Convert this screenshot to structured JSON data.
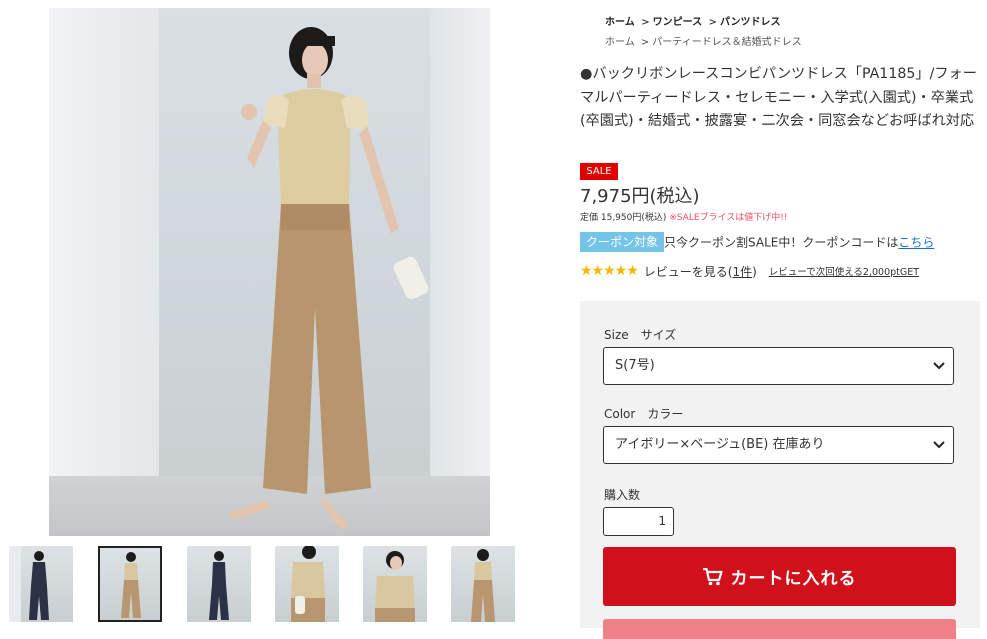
{
  "breadcrumb": {
    "row1": [
      "ホーム",
      "ワンピース",
      "パンツドレス"
    ],
    "row2": [
      "ホーム",
      "パーティードレス＆結婚式ドレス"
    ],
    "separator": ">"
  },
  "product": {
    "title": "●バックリボンレースコンビパンツドレス「PA1185」/フォーマルパーティードレス・セレモニー・入学式(入園式)・卒業式(卒園式)・結婚式・披露宴・二次会・同窓会などお呼ばれ対応",
    "sale_badge": "SALE",
    "price": "7,975円(税込)",
    "original_price": "定価 15,950円(税込)",
    "original_price_note": "※SALEプライスは値下げ中!!"
  },
  "coupon": {
    "tag": "クーポン対象",
    "text": "只今クーポン割SALE中！クーポンコードは",
    "link": "こちら"
  },
  "review": {
    "stars": 5,
    "stars_text": "★★★★★",
    "label": "レビューを見る(",
    "count": "1件",
    "label_end": ")",
    "promo": "レビューで次回使える2,000ptGET"
  },
  "options": {
    "size_label": "Size　サイズ",
    "size_value": "S(7号)",
    "color_label": "Color　カラー",
    "color_value": "アイボリー×ベージュ(BE)  在庫あり",
    "qty_label": "購入数",
    "qty_value": "1"
  },
  "cart": {
    "label": "カートに入れる",
    "icon": "cart-icon"
  },
  "colors": {
    "sale_red": "#e00000",
    "cart_red": "#d0101a",
    "coupon_blue": "#74c4e8",
    "star_gold": "#f2b800",
    "link_blue": "#1a6fc8",
    "note_pink": "#e94f64"
  },
  "thumbnails": [
    {
      "alt": "thumb-navy-front",
      "garment": "#2b3245",
      "top": "#2b3245"
    },
    {
      "alt": "thumb-beige-front",
      "garment": "#b89670",
      "top": "#d9c7a0",
      "active": true
    },
    {
      "alt": "thumb-navy-back",
      "garment": "#2b3245",
      "top": "#2b3245"
    },
    {
      "alt": "thumb-beige-detail",
      "garment": "#b89670",
      "top": "#d9c7a0"
    },
    {
      "alt": "thumb-beige-upper",
      "garment": "#b89670",
      "top": "#d9c7a0"
    },
    {
      "alt": "thumb-beige-back",
      "garment": "#b89670",
      "top": "#d9c7a0"
    }
  ]
}
